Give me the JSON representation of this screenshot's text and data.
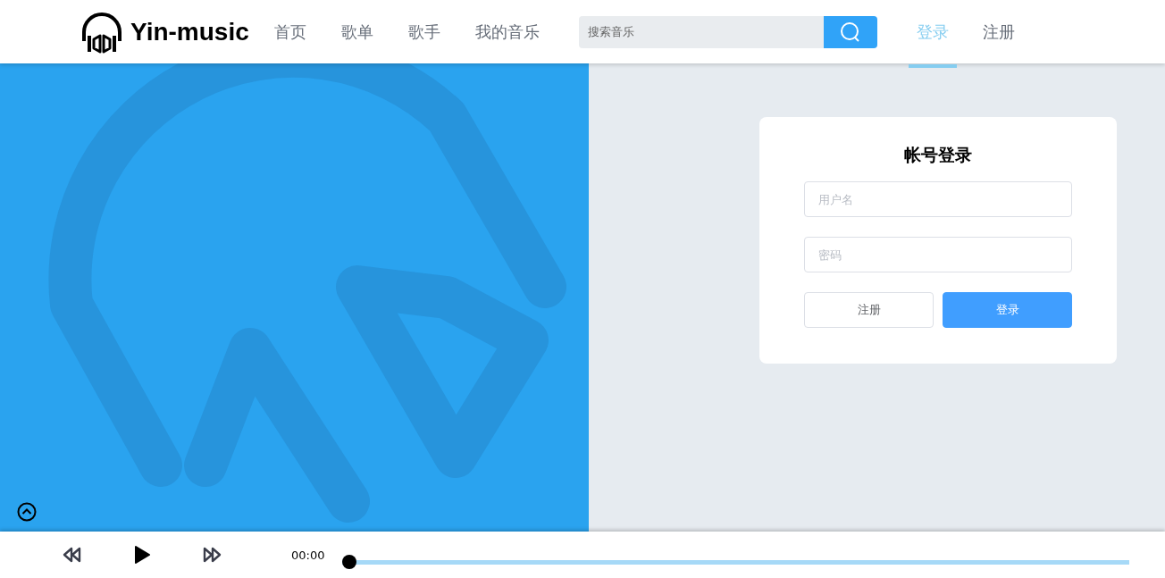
{
  "header": {
    "logo_text": "Yin-music",
    "nav": [
      {
        "label": "首页",
        "selected": false
      },
      {
        "label": "歌单",
        "selected": false
      },
      {
        "label": "歌手",
        "selected": false
      },
      {
        "label": "我的音乐",
        "selected": false
      }
    ],
    "search": {
      "placeholder": "搜索音乐"
    },
    "account_links": [
      {
        "label": "登录",
        "selected": true
      },
      {
        "label": "注册",
        "selected": false
      }
    ]
  },
  "login_card": {
    "title": "帐号登录",
    "username": {
      "placeholder": "用户名"
    },
    "password": {
      "placeholder": "密码"
    },
    "buttons": [
      {
        "label": "注册",
        "kind": "secondary"
      },
      {
        "label": "登录",
        "kind": "primary"
      }
    ]
  },
  "player": {
    "current_time": "00:00",
    "progress": {
      "level": 0
    }
  }
}
